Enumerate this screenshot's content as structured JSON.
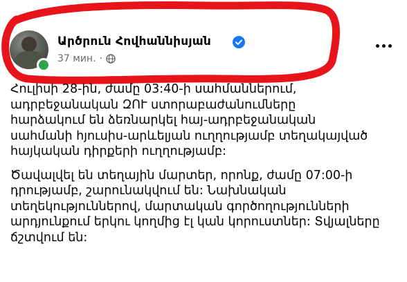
{
  "post": {
    "author_name": "Արծրուն Հովհաննիսյան",
    "timestamp": "37 мин.",
    "separator": "·",
    "audience_icon": "globe-icon",
    "verified_icon": "verified-badge-icon",
    "paragraphs": [
      "Հուլիսի 28-ին, ժամը 03:40-ի սահմաններում,\nադրբեջանական ԶՈՒ ստորաբաժանումները\nհարձակում են ձեռնարկել հայ-ադրբեջանական\nսահմանի հյուսիս-արևելյան ուղղությամբ տեղակայված\nհայկական դիրքերի ուղղությամբ:",
      "Ծավալվել են տեղային մարտեր, որոնք, ժամը 07:00-ի\nդրությամբ, շարունակվում են: Նախնական\nտեղեկություններով, մարտական գործողությունների\nարդյունքում երկու կողմից էլ կան կորուստներ: Տվյալները\nճշտվում են:"
    ]
  },
  "colors": {
    "highlight_stroke": "#e8141c",
    "verified": "#1877f2",
    "meta_text": "#65676b",
    "online": "#31a24c"
  }
}
